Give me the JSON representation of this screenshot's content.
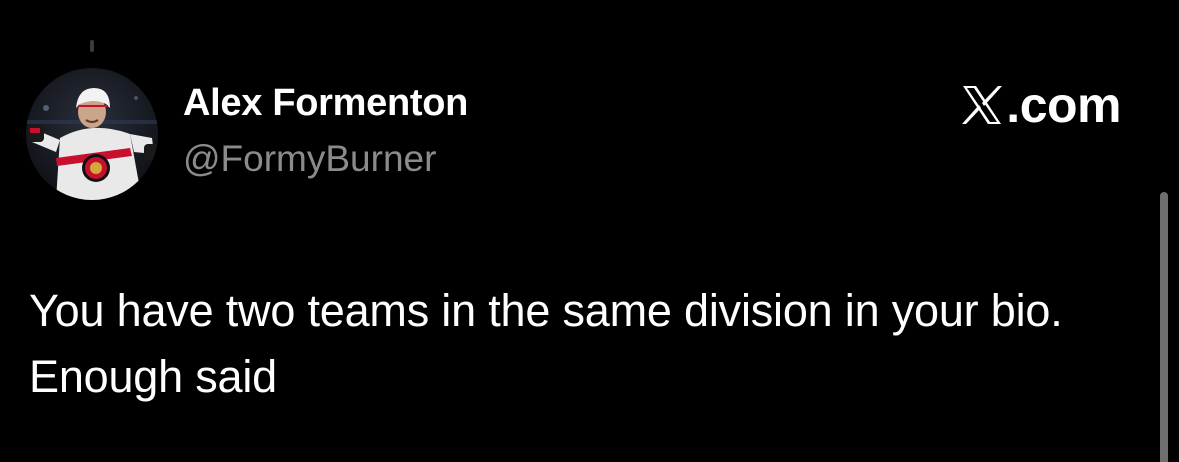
{
  "tweet": {
    "author": {
      "display_name": "Alex Formenton",
      "handle": "@FormyBurner",
      "avatar": "hockey-player-avatar"
    },
    "brand": {
      "icon": "x-logo-icon",
      "domain": ".com"
    },
    "text": "You have two teams in the same division in your bio. Enough said"
  },
  "colors": {
    "background": "#000000",
    "primary_text": "#ffffff",
    "secondary_text": "#8b8b8b",
    "scrollbar": "#6e6e6e"
  }
}
